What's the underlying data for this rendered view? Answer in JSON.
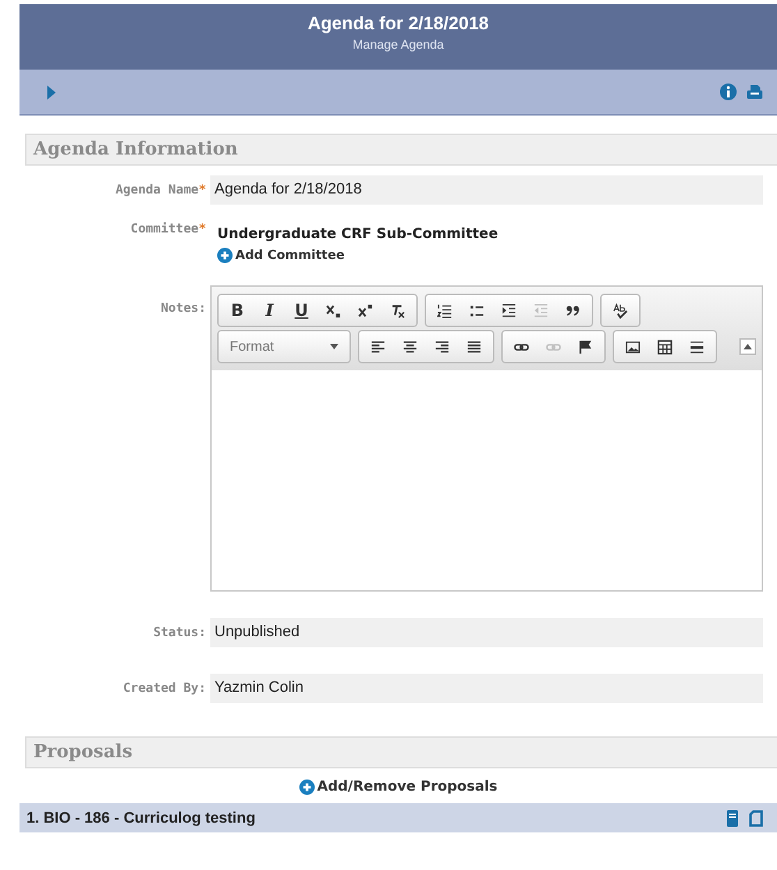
{
  "header": {
    "title": "Agenda for 2/18/2018",
    "subtitle": "Manage Agenda"
  },
  "section_info": {
    "title": "Agenda Information"
  },
  "fields": [
    {
      "kind": "text",
      "label": "Agenda Name",
      "marker": "*",
      "value": "Agenda for 2/18/2018"
    },
    {
      "kind": "committee",
      "label": "Committee",
      "marker": "*",
      "value": "Undergraduate CRF Sub-Committee",
      "action": "Add Committee"
    },
    {
      "kind": "editor",
      "label": "Notes:"
    },
    {
      "kind": "text",
      "label": "Status:",
      "value": "Unpublished"
    },
    {
      "kind": "text",
      "label": "Created By:",
      "value": "Yazmin Colin"
    }
  ],
  "toolbar": [
    [
      [
        {
          "kind": "bold",
          "label": "B",
          "disabled": false
        },
        {
          "kind": "italic",
          "label": "I",
          "disabled": false
        },
        {
          "kind": "underline",
          "label": "U",
          "disabled": false
        },
        {
          "kind": "subscript",
          "disabled": false
        },
        {
          "kind": "superscript",
          "disabled": false
        },
        {
          "kind": "clear",
          "disabled": false
        }
      ],
      [
        {
          "kind": "numlist",
          "disabled": false
        },
        {
          "kind": "bullist",
          "disabled": false
        },
        {
          "kind": "indent",
          "disabled": false
        },
        {
          "kind": "outdent",
          "disabled": true
        },
        {
          "kind": "quote",
          "disabled": false
        }
      ],
      [
        {
          "kind": "spell",
          "disabled": false
        }
      ]
    ],
    [
      [
        {
          "kind": "format",
          "label": "Format"
        }
      ],
      [
        {
          "kind": "alignleft",
          "disabled": false
        },
        {
          "kind": "aligncenter",
          "disabled": false
        },
        {
          "kind": "alignright",
          "disabled": false
        },
        {
          "kind": "justify",
          "disabled": false
        }
      ],
      [
        {
          "kind": "link",
          "disabled": false
        },
        {
          "kind": "unlink",
          "disabled": true
        },
        {
          "kind": "flag",
          "disabled": false
        }
      ],
      [
        {
          "kind": "image",
          "disabled": false
        },
        {
          "kind": "table",
          "disabled": false
        },
        {
          "kind": "hr",
          "disabled": false
        }
      ]
    ]
  ],
  "section_proposals": {
    "title": "Proposals",
    "action": "Add/Remove Proposals"
  },
  "proposals": [
    {
      "title": "1. BIO - 186 - Curriculog testing"
    }
  ]
}
